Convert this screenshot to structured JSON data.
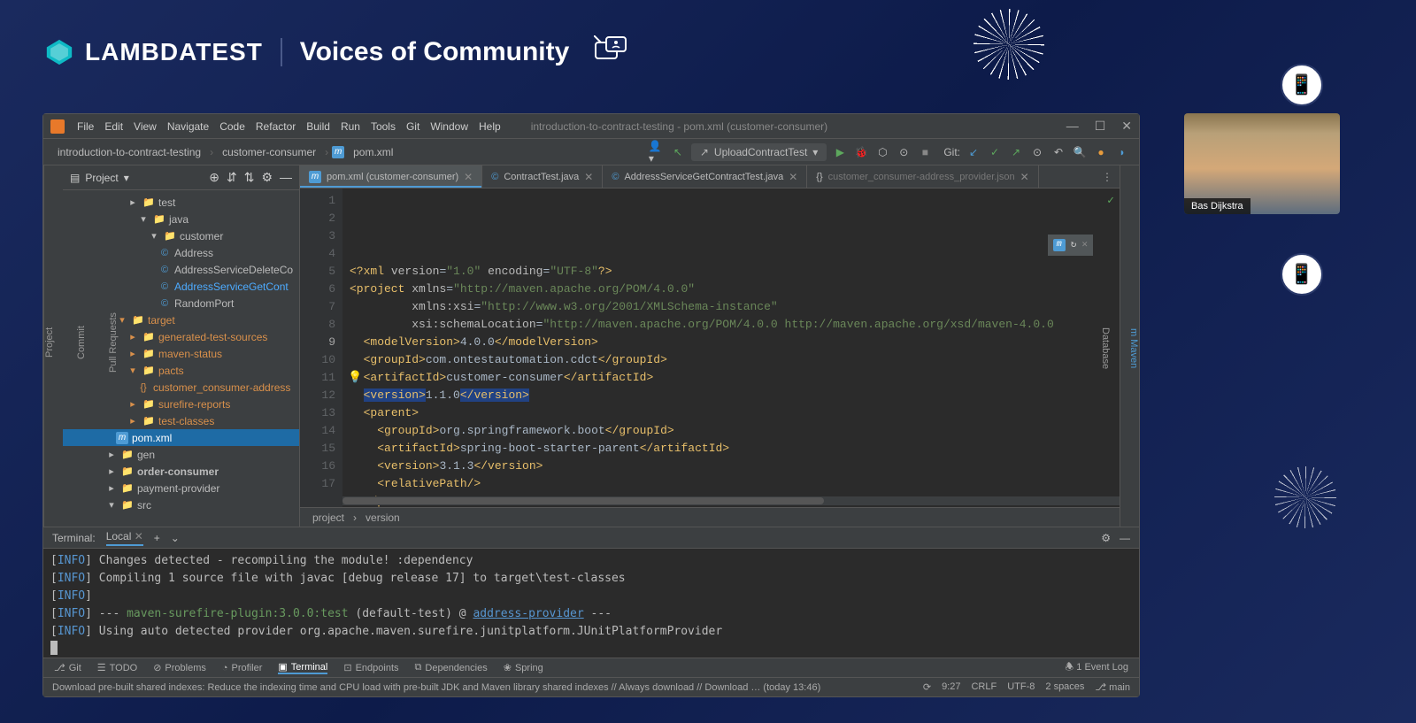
{
  "header": {
    "brand": "LAMBDATEST",
    "tagline": "Voices of Community"
  },
  "ide": {
    "menu": [
      "File",
      "Edit",
      "View",
      "Navigate",
      "Code",
      "Refactor",
      "Build",
      "Run",
      "Tools",
      "Git",
      "Window",
      "Help"
    ],
    "title": "introduction-to-contract-testing - pom.xml (customer-consumer)",
    "breadcrumb": [
      "introduction-to-contract-testing",
      "customer-consumer",
      "pom.xml"
    ],
    "runConfig": "UploadContractTest",
    "gitLabel": "Git:",
    "project": {
      "header": "Project",
      "tree": [
        {
          "depth": 6,
          "icon": "▸",
          "iconClass": "",
          "icon2": "📁",
          "name": "test",
          "cls": ""
        },
        {
          "depth": 7,
          "icon": "▾",
          "icon2": "📁",
          "name": "java",
          "cls": "",
          "folder": "folder-green"
        },
        {
          "depth": 8,
          "icon": "▾",
          "icon2": "📁",
          "name": "customer",
          "cls": ""
        },
        {
          "depth": 9,
          "icon": "",
          "icon2": "©",
          "name": "Address",
          "cls": "",
          "file": "file-blue"
        },
        {
          "depth": 9,
          "icon": "",
          "icon2": "©",
          "name": "AddressServiceDeleteCo",
          "cls": "",
          "file": "file-blue"
        },
        {
          "depth": 9,
          "icon": "",
          "icon2": "©",
          "name": "AddressServiceGetCont",
          "cls": "highlighted",
          "file": "file-blue"
        },
        {
          "depth": 9,
          "icon": "",
          "icon2": "©",
          "name": "RandomPort",
          "cls": "",
          "file": "file-blue"
        },
        {
          "depth": 5,
          "icon": "▾",
          "icon2": "📁",
          "name": "target",
          "cls": "orange-text",
          "folder": "folder-orange"
        },
        {
          "depth": 6,
          "icon": "▸",
          "icon2": "📁",
          "name": "generated-test-sources",
          "cls": "orange-text",
          "folder": "folder-orange"
        },
        {
          "depth": 6,
          "icon": "▸",
          "icon2": "📁",
          "name": "maven-status",
          "cls": "orange-text",
          "folder": "folder-orange"
        },
        {
          "depth": 6,
          "icon": "▾",
          "icon2": "📁",
          "name": "pacts",
          "cls": "orange-text",
          "folder": "folder-orange"
        },
        {
          "depth": 7,
          "icon": "",
          "icon2": "{}",
          "name": "customer_consumer-address",
          "cls": "orange-text"
        },
        {
          "depth": 6,
          "icon": "▸",
          "icon2": "📁",
          "name": "surefire-reports",
          "cls": "orange-text",
          "folder": "folder-orange"
        },
        {
          "depth": 6,
          "icon": "▸",
          "icon2": "📁",
          "name": "test-classes",
          "cls": "orange-text",
          "folder": "folder-orange"
        },
        {
          "depth": 5,
          "icon": "",
          "icon2": "m",
          "name": "pom.xml",
          "cls": "selected"
        },
        {
          "depth": 4,
          "icon": "▸",
          "icon2": "📁",
          "name": "gen",
          "cls": ""
        },
        {
          "depth": 4,
          "icon": "▸",
          "icon2": "📁",
          "name": "order-consumer",
          "cls": "",
          "bold": true
        },
        {
          "depth": 4,
          "icon": "▸",
          "icon2": "📁",
          "name": "payment-provider",
          "cls": ""
        },
        {
          "depth": 4,
          "icon": "▾",
          "icon2": "📁",
          "name": "src",
          "cls": ""
        }
      ]
    },
    "tabs": [
      {
        "icon": "m",
        "label": "pom.xml (customer-consumer)",
        "active": true
      },
      {
        "icon": "©",
        "label": "ContractTest.java",
        "active": false
      },
      {
        "icon": "©",
        "label": "AddressServiceGetContractTest.java",
        "active": false
      },
      {
        "icon": "{}",
        "label": "customer_consumer-address_provider.json",
        "active": false,
        "faded": true
      }
    ],
    "code": {
      "lines": [
        {
          "n": 1,
          "html": "<span class='kw'>&lt;?xml</span> <span class='attr'>version</span>=<span class='str'>\"1.0\"</span> <span class='attr'>encoding</span>=<span class='str'>\"UTF-8\"</span><span class='kw'>?&gt;</span>"
        },
        {
          "n": 2,
          "html": "<span class='kw'>&lt;project</span> <span class='attr'>xmlns</span>=<span class='str'>\"http://maven.apache.org/POM/4.0.0\"</span>"
        },
        {
          "n": 3,
          "html": "         <span class='attr'>xmlns:xsi</span>=<span class='str'>\"http://www.w3.org/2001/XMLSchema-instance\"</span>"
        },
        {
          "n": 4,
          "html": "         <span class='attr'>xsi:schemaLocation</span>=<span class='str'>\"http://maven.apache.org/POM/4.0.0 http://maven.apache.org/xsd/maven-4.0.0</span>"
        },
        {
          "n": 5,
          "html": "  <span class='kw'>&lt;modelVersion&gt;</span>4.0.0<span class='kw'>&lt;/modelVersion&gt;</span>"
        },
        {
          "n": 6,
          "html": ""
        },
        {
          "n": 7,
          "html": "  <span class='kw'>&lt;groupId&gt;</span>com.ontestautomation.cdct<span class='kw'>&lt;/groupId&gt;</span>"
        },
        {
          "n": 8,
          "html": "<span class='bulb'>💡</span>  <span class='kw'>&lt;artifactId&gt;</span>customer-consumer<span class='kw'>&lt;/artifactId&gt;</span>"
        },
        {
          "n": 9,
          "curr": true,
          "html": "  <span class='sel-bg'><span class='kw'>&lt;version&gt;</span></span>1.1.0<span class='sel-bg'><span class='kw'>&lt;/version&gt;</span></span>"
        },
        {
          "n": 10,
          "html": ""
        },
        {
          "n": 11,
          "html": "  <span class='kw'>&lt;parent&gt;</span>"
        },
        {
          "n": 12,
          "html": "    <span class='kw'>&lt;groupId&gt;</span>org.springframework.boot<span class='kw'>&lt;/groupId&gt;</span>"
        },
        {
          "n": 13,
          "html": "    <span class='kw'>&lt;artifactId&gt;</span>spring-boot-starter-parent<span class='kw'>&lt;/artifactId&gt;</span>"
        },
        {
          "n": 14,
          "html": "    <span class='kw'>&lt;version&gt;</span>3.1.3<span class='kw'>&lt;/version&gt;</span>"
        },
        {
          "n": 15,
          "html": "    <span class='kw'>&lt;relativePath/&gt;</span>"
        },
        {
          "n": 16,
          "html": "  <span class='kw'>&lt;/parent&gt;</span>"
        },
        {
          "n": 17,
          "html": ""
        }
      ]
    },
    "crumbPath": [
      "project",
      "version"
    ],
    "terminal": {
      "label": "Terminal:",
      "tab": "Local",
      "lines": [
        "[<span class='info-lbl'>INFO</span>] Changes detected - recompiling the module! :dependency",
        "[<span class='info-lbl'>INFO</span>] Compiling 1 source file with javac [debug release 17] to target\\test-classes",
        "[<span class='info-lbl'>INFO</span>]",
        "[<span class='info-lbl'>INFO</span>] --- <span class='mvn'>maven-surefire-plugin:3.0.0:test</span> (default-test) @ <span class='link'>address-provider</span> ---",
        "[<span class='info-lbl'>INFO</span>] Using auto detected provider org.apache.maven.surefire.junitplatform.JUnitPlatformProvider"
      ]
    },
    "bottomTabs": [
      "Git",
      "TODO",
      "Problems",
      "Profiler",
      "Terminal",
      "Endpoints",
      "Dependencies",
      "Spring"
    ],
    "eventLog": "1 Event Log",
    "status": {
      "msg": "Download pre-built shared indexes: Reduce the indexing time and CPU load with pre-built JDK and Maven library shared indexes // Always download // Download … (today 13:46)",
      "right": [
        "9:27",
        "CRLF",
        "UTF-8",
        "2 spaces",
        "⎇ main"
      ]
    }
  },
  "webcam": {
    "name": "Bas Dijkstra"
  }
}
